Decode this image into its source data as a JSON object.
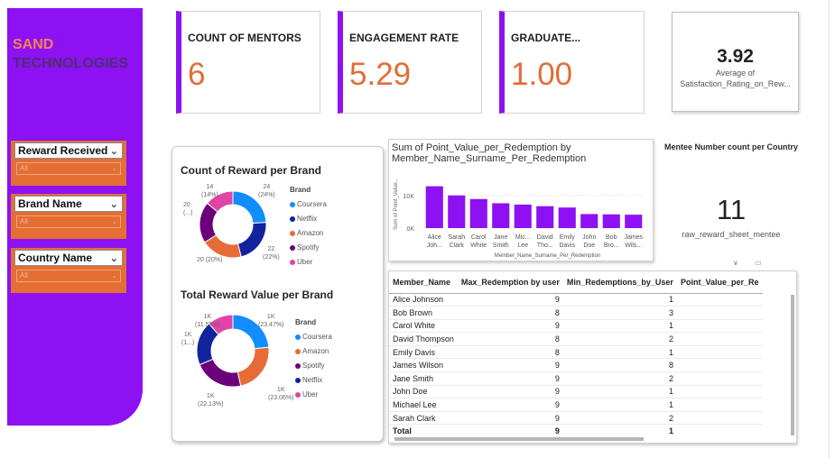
{
  "logo": {
    "line1": "SAND",
    "line2": "TECHNOLOGIES"
  },
  "slicers": [
    {
      "title": "Reward Received",
      "value": "All"
    },
    {
      "title": "Brand Name",
      "value": "All"
    },
    {
      "title": "Country Name",
      "value": "All"
    }
  ],
  "cards": [
    {
      "title": "COUNT OF MENTORS",
      "value": "6"
    },
    {
      "title": "ENGAGEMENT RATE",
      "value": "5.29"
    },
    {
      "title": "GRADUATE...",
      "value": "1.00"
    }
  ],
  "satisfaction": {
    "value": "3.92",
    "label1": "Average of",
    "label2": "Satisfaction_Rating_on_Rew..."
  },
  "mentee": {
    "title": "Mentee Number count per Country",
    "value": "11",
    "label": "raw_reward_sheet_mentee"
  },
  "colors": {
    "accent": "#8d11f2",
    "orange": "#e26d38",
    "coursera": "#118dff",
    "netflix": "#12239e",
    "amazon": "#e66c37",
    "spotify": "#6b007b",
    "uber": "#e044a7",
    "bar": "#8d11f2"
  },
  "chart_data": [
    {
      "type": "pie",
      "title": "Count of Reward per Brand",
      "legend_title": "Brand",
      "legend": [
        "Coursera",
        "Netflix",
        "Amazon",
        "Spotify",
        "Uber"
      ],
      "slices": [
        {
          "name": "Coursera",
          "value": 24,
          "label": "24",
          "label2": "(24%)"
        },
        {
          "name": "Netflix",
          "value": 22,
          "label": "22",
          "label2": "(22%)"
        },
        {
          "name": "Amazon",
          "value": 20,
          "label": "20 (20%)",
          "label2": ""
        },
        {
          "name": "Spotify",
          "value": 20,
          "label": "20",
          "label2": "(...)"
        },
        {
          "name": "Uber",
          "value": 14,
          "label": "14",
          "label2": "(14%)"
        }
      ]
    },
    {
      "type": "pie",
      "title": "Total Reward Value per Brand",
      "legend_title": "Brand",
      "legend": [
        "Coursera",
        "Amazon",
        "Spotify",
        "Netflix",
        "Uber"
      ],
      "slices": [
        {
          "name": "Coursera",
          "value": 23.47,
          "label": "1K",
          "label2": "(23.47%)"
        },
        {
          "name": "Amazon",
          "value": 23.06,
          "label": "1K",
          "label2": "(23.06%)"
        },
        {
          "name": "Spotify",
          "value": 22.13,
          "label": "1K",
          "label2": "(22.13%)"
        },
        {
          "name": "Netflix",
          "value": 19.76,
          "label": "1K",
          "label2": "(1...)"
        },
        {
          "name": "Uber",
          "value": 11.58,
          "label": "1K",
          "label2": "(11.58%)"
        }
      ]
    },
    {
      "type": "bar",
      "title": "Sum of Point_Value_per_Redemption by Member_Name_Surname_Per_Redemption",
      "xlabel": "Member_Name_Surname_Per_Redemption",
      "ylabel": "Sum of Point_Value...",
      "yticks": [
        "0K",
        "10K"
      ],
      "ylim": [
        0,
        16000
      ],
      "categories": [
        [
          "Alice",
          "Joh..."
        ],
        [
          "Sarah",
          "Clark"
        ],
        [
          "Carol",
          "White"
        ],
        [
          "Jane",
          "Smith"
        ],
        [
          "Mic...",
          "Lee"
        ],
        [
          "David",
          "Tho..."
        ],
        [
          "Emily",
          "Davis"
        ],
        [
          "John",
          "Doe"
        ],
        [
          "Bob",
          "Bro..."
        ],
        [
          "James",
          "Wils..."
        ]
      ],
      "values": [
        12800,
        10000,
        8900,
        7600,
        7200,
        6700,
        6300,
        4300,
        4200,
        4100
      ]
    },
    {
      "type": "table",
      "columns": [
        "Member_Name",
        "Max_Redemption by user",
        "Min_Redemptions_by_User",
        "Point_Value_per_Re"
      ],
      "rows": [
        [
          "Alice Johnson",
          "9",
          "1"
        ],
        [
          "Bob Brown",
          "8",
          "3"
        ],
        [
          "Carol White",
          "9",
          "1"
        ],
        [
          "David Thompson",
          "8",
          "2"
        ],
        [
          "Emily Davis",
          "8",
          "1"
        ],
        [
          "James Wilson",
          "9",
          "8"
        ],
        [
          "Jane Smith",
          "9",
          "2"
        ],
        [
          "John Doe",
          "9",
          "1"
        ],
        [
          "Michael Lee",
          "9",
          "1"
        ],
        [
          "Sarah Clark",
          "9",
          "2"
        ]
      ],
      "total": [
        "Total",
        "9",
        "1"
      ]
    }
  ]
}
